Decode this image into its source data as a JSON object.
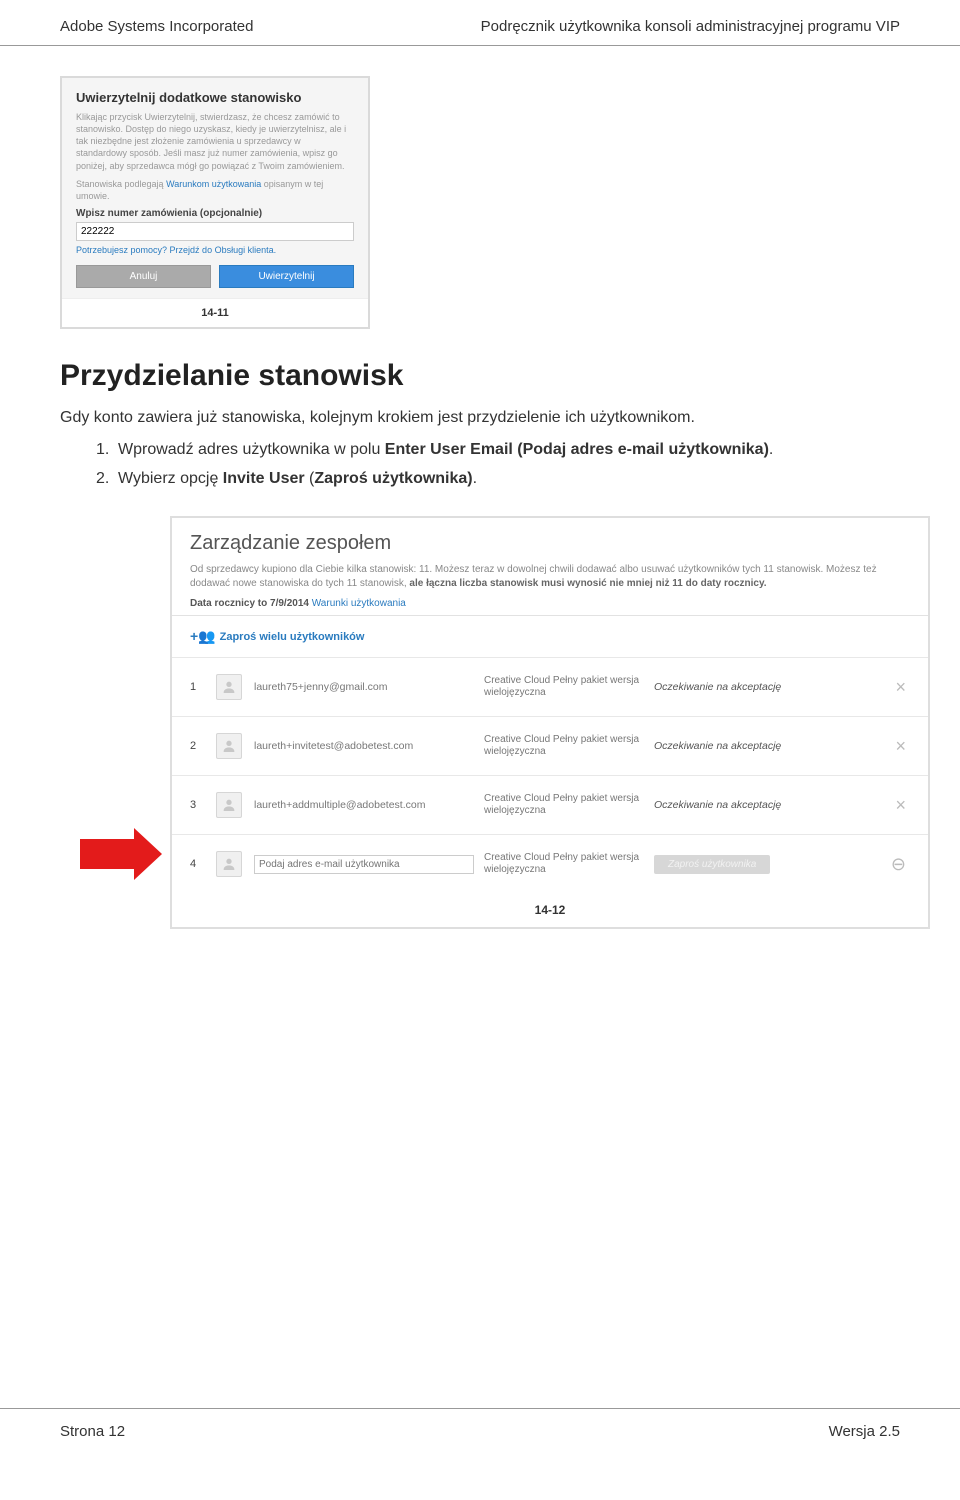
{
  "doc": {
    "header_left": "Adobe Systems Incorporated",
    "header_right": "Podręcznik użytkownika konsoli administracyjnej programu VIP",
    "footer_left": "Strona 12",
    "footer_right": "Wersja 2.5"
  },
  "dialog": {
    "title": "Uwierzytelnij dodatkowe stanowisko",
    "p1_a": "Klikając przycisk Uwierzytelnij, stwierdzasz, że chcesz zamówić to stanowisko. Dostęp do niego uzyskasz, kiedy je uwierzytelnisz, ale i tak niezbędne jest złożenie zamówienia u sprzedawcy w standardowy sposób. Jeśli masz już numer zamówienia, wpisz go poniżej, aby sprzedawca mógł go powiązać z Twoim zamówieniem.",
    "p2_a": "Stanowiska podlegają ",
    "p2_link": "Warunkom użytkowania",
    "p2_b": " opisanym w tej umowie.",
    "input_label": "Wpisz numer zamówienia (opcjonalnie)",
    "input_value": "222222",
    "help": "Potrzebujesz pomocy? Przejdź do Obsługi klienta.",
    "cancel": "Anuluj",
    "auth": "Uwierzytelnij",
    "caption": "14-11"
  },
  "content": {
    "heading": "Przydzielanie stanowisk",
    "intro": "Gdy konto zawiera już stanowiska, kolejnym krokiem jest przydzielenie ich użytkownikom.",
    "step1_a": "Wprowadź adres użytkownika w polu ",
    "step1_b": "Enter User Email (Podaj adres e-mail użytkownika)",
    "step1_c": ".",
    "step2_a": "Wybierz opcję ",
    "step2_b": "Invite User",
    "step2_c": " (",
    "step2_d": "Zaproś użytkownika)",
    "step2_e": "."
  },
  "team": {
    "title": "Zarządzanie zespołem",
    "desc_a": "Od sprzedawcy kupiono dla Ciebie kilka stanowisk: 11. Możesz teraz w dowolnej chwili dodawać albo usuwać użytkowników tych 11 stanowisk. Możesz też dodawać nowe stanowiska do tych 11 stanowisk, ",
    "desc_b": "ale łączna liczba stanowisk musi wynosić nie mniej niż 11 do daty rocznicy.",
    "date_a": "Data rocznicy to 7/9/2014 ",
    "date_link": "Warunki użytkowania",
    "invite_link": "Zaproś wielu użytkowników",
    "product": "Creative Cloud Pełny pakiet wersja wielojęzyczna",
    "status_wait": "Oczekiwanie na akceptację",
    "rows": [
      {
        "n": "1",
        "email": "laureth75+jenny@gmail.com"
      },
      {
        "n": "2",
        "email": "laureth+invitetest@adobetest.com"
      },
      {
        "n": "3",
        "email": "laureth+addmultiple@adobetest.com"
      }
    ],
    "row4_n": "4",
    "row4_placeholder": "Podaj adres e-mail użytkownika",
    "invite_btn": "Zaproś użytkownika",
    "caption": "14-12"
  }
}
